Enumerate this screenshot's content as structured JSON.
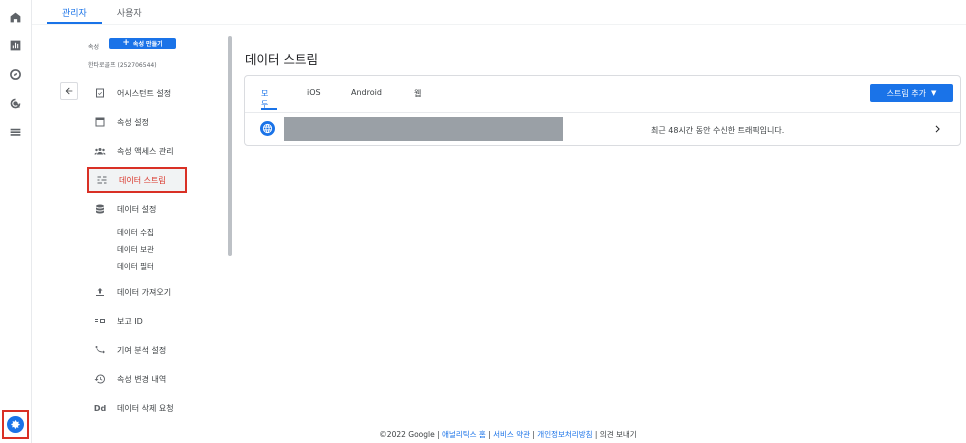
{
  "top_tabs": [
    {
      "label": "관리자",
      "active": true
    },
    {
      "label": "사용자",
      "active": false
    }
  ],
  "sidebar": {
    "property_label": "속성",
    "create_property_label": "속성 만들기",
    "account_name": "한타로골프 (252706544)",
    "items": [
      {
        "label": "어시스턴트 설정",
        "icon": "checklist-icon"
      },
      {
        "label": "속성 설정",
        "icon": "property-settings-icon"
      },
      {
        "label": "속성 액세스 관리",
        "icon": "people-icon"
      },
      {
        "label": "데이터 스트림",
        "icon": "data-streams-icon",
        "active": true
      },
      {
        "label": "데이터 설정",
        "icon": "database-icon"
      },
      {
        "label": "데이터 가져오기",
        "icon": "upload-icon"
      },
      {
        "label": "보고 ID",
        "icon": "reporting-id-icon"
      },
      {
        "label": "기여 분석 설정",
        "icon": "attribution-icon"
      },
      {
        "label": "속성 변경 내역",
        "icon": "history-icon"
      },
      {
        "label": "데이터 삭제 요청",
        "icon": "delete-request-icon"
      }
    ],
    "data_settings_sub": [
      "데이터 수집",
      "데이터 보관",
      "데이터 필터"
    ]
  },
  "main": {
    "title": "데이터 스트림",
    "tabs": [
      "모두",
      "iOS",
      "Android",
      "웹"
    ],
    "add_stream_label": "스트림 추가",
    "stream_row": {
      "status": "최근 48시간 동안 수신한 트래픽입니다."
    }
  },
  "footer": {
    "copyright": "©2022 Google",
    "sep": " | ",
    "links": [
      "애널리틱스 홈",
      "서비스 약관",
      "개인정보처리방침"
    ],
    "feedback": "의견 보내기"
  },
  "colors": {
    "accent": "#1a73e8",
    "highlight": "#d93025"
  }
}
